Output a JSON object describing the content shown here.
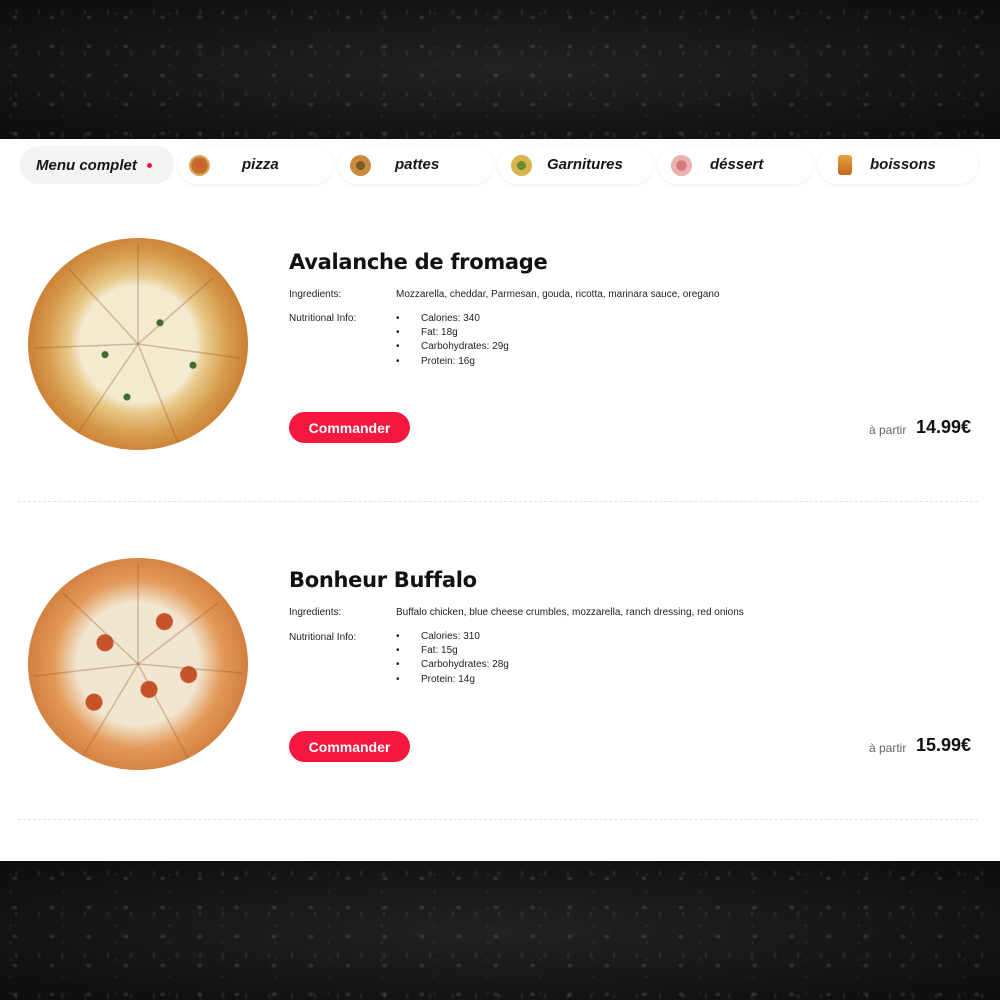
{
  "nav": {
    "items": [
      {
        "label": "Menu complet",
        "icon": "active-dot"
      },
      {
        "label": "pizza",
        "icon": "pizza-icon"
      },
      {
        "label": "pattes",
        "icon": "pasta-icon"
      },
      {
        "label": "Garnitures",
        "icon": "sides-icon"
      },
      {
        "label": "déssert",
        "icon": "dessert-icon"
      },
      {
        "label": "boissons",
        "icon": "drink-icon"
      }
    ],
    "active_index": 0
  },
  "products": [
    {
      "name": "Avalanche de fromage",
      "ingredients_label": "Ingredients:",
      "ingredients": "Mozzarella, cheddar, Parmesan, gouda, ricotta, marinara sauce, oregano",
      "nutrition_label": "Nutritional Info:",
      "nutrition": [
        "Calories: 340",
        "Fat: 18g",
        "Carbohydrates: 29g",
        "Protein: 16g"
      ],
      "order_label": "Commander",
      "price_prefix": "à partir",
      "price": "14.99€"
    },
    {
      "name": "Bonheur Buffalo",
      "ingredients_label": "Ingredients:",
      "ingredients": "Buffalo chicken, blue cheese crumbles, mozzarella, ranch dressing, red onions",
      "nutrition_label": "Nutritional Info:",
      "nutrition": [
        "Calories: 310",
        "Fat: 15g",
        "Carbohydrates: 28g",
        "Protein: 14g"
      ],
      "order_label": "Commander",
      "price_prefix": "à partir",
      "price": "15.99€"
    }
  ],
  "colors": {
    "accent": "#f5173f",
    "background": "#141414",
    "panel": "#ffffff"
  }
}
